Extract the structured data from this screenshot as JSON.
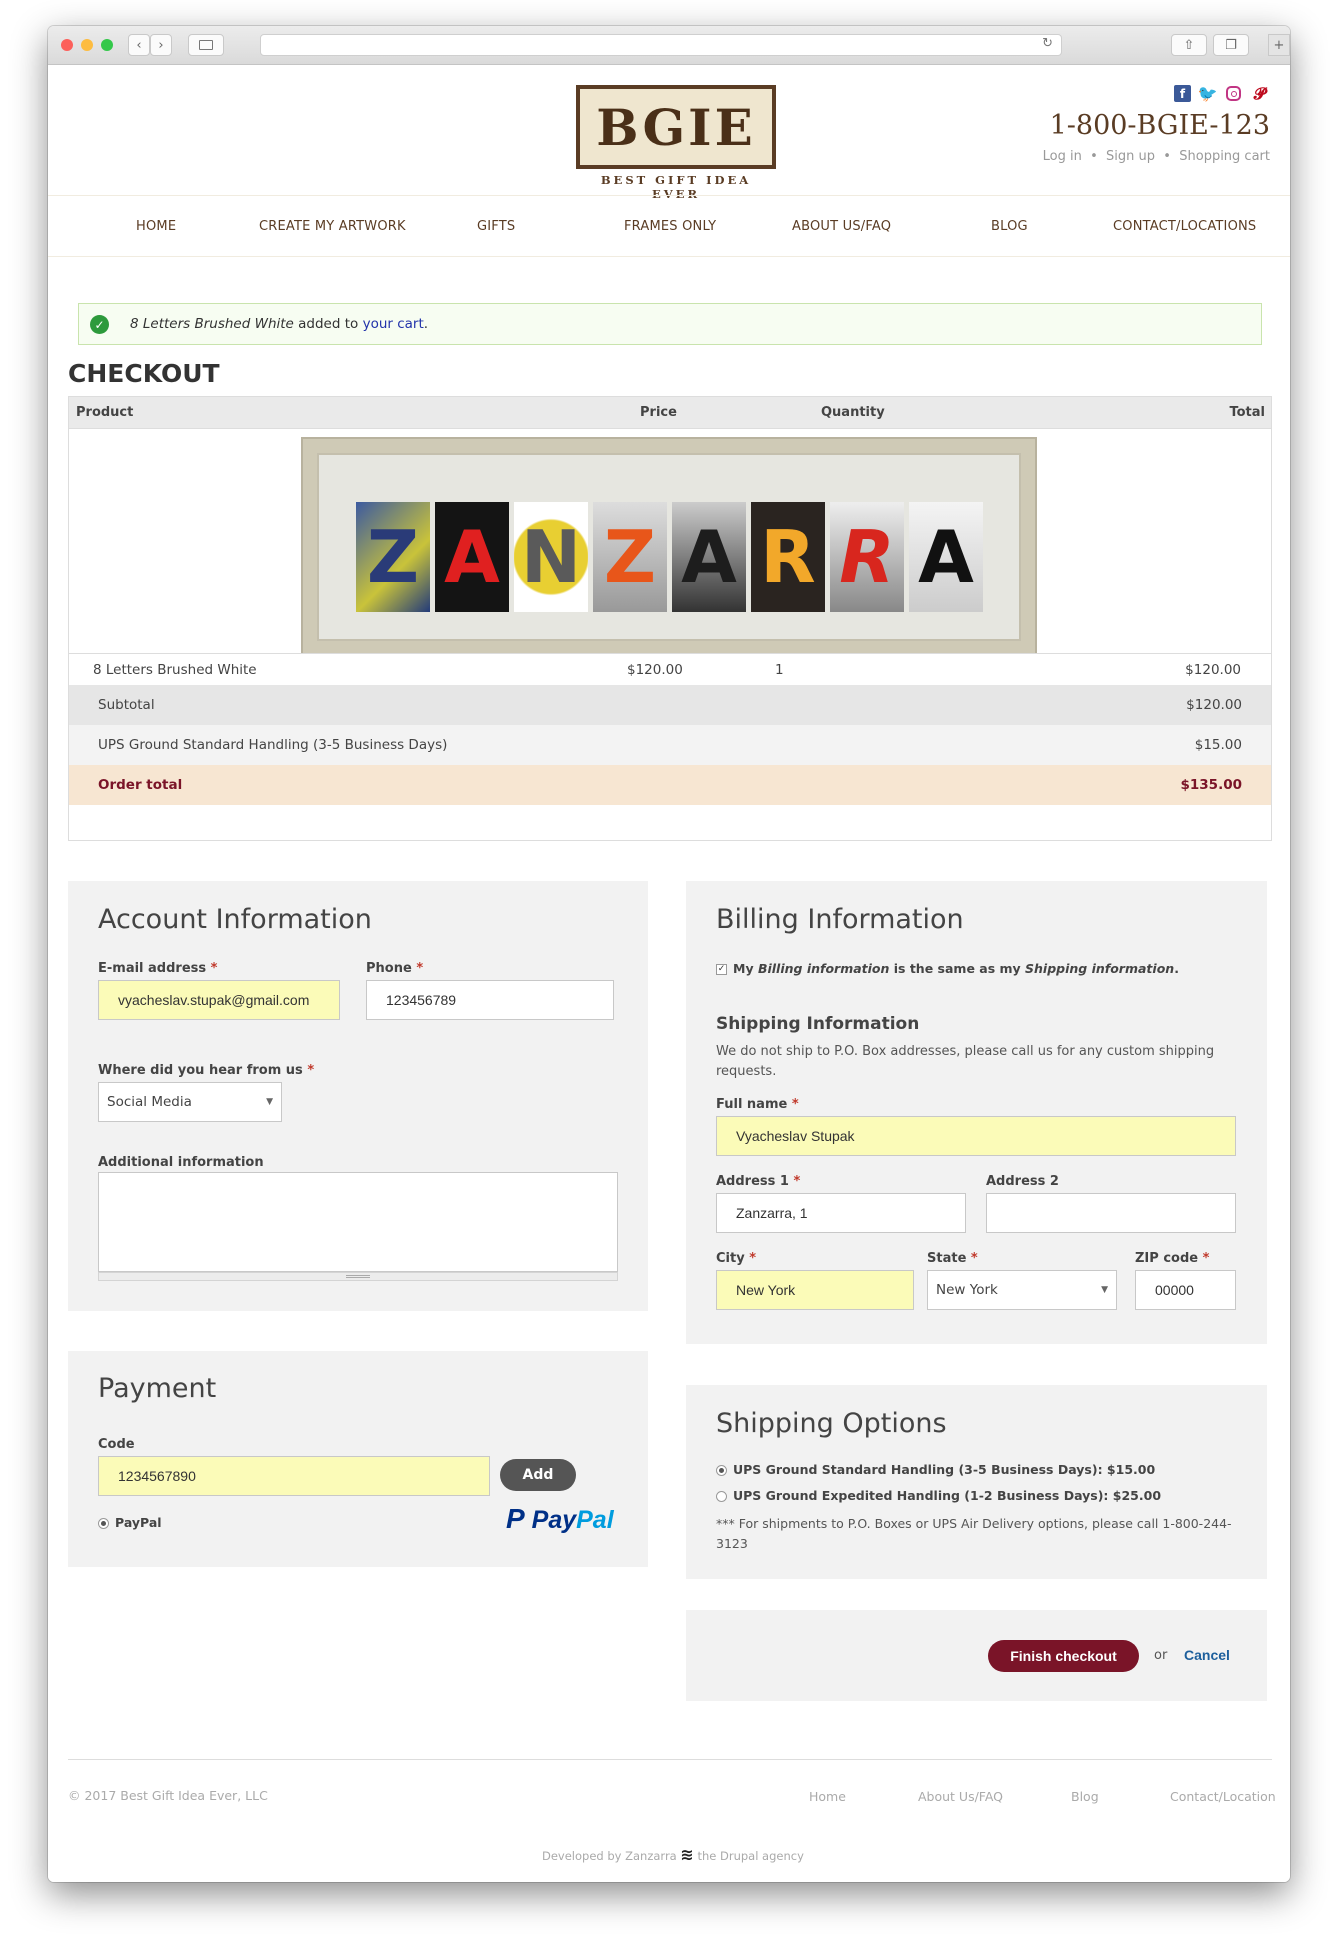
{
  "site": {
    "logo_text": "BGIE",
    "tagline": "BEST GIFT IDEA EVER",
    "phone": "1-800-BGIE-123",
    "top_links": [
      "Log in",
      "Sign up",
      "Shopping cart"
    ],
    "social_icons": [
      "facebook-icon",
      "twitter-icon",
      "instagram-icon",
      "pinterest-icon"
    ]
  },
  "nav": [
    "HOME",
    "CREATE MY ARTWORK",
    "GIFTS",
    "FRAMES ONLY",
    "ABOUT US/FAQ",
    "BLOG",
    "CONTACT/LOCATIONS"
  ],
  "alert": {
    "product": "8 Letters Brushed White",
    "middle": " added to ",
    "link": "your cart",
    "end": "."
  },
  "checkout": {
    "title": "CHECKOUT",
    "columns": {
      "product": "Product",
      "price": "Price",
      "quantity": "Quantity",
      "total": "Total"
    },
    "artwork_letters": [
      "Z",
      "A",
      "N",
      "Z",
      "A",
      "R",
      "R",
      "A"
    ],
    "item": {
      "name": "8 Letters Brushed White",
      "price": "$120.00",
      "quantity": "1",
      "total": "$120.00"
    },
    "subtotal": {
      "label": "Subtotal",
      "value": "$120.00"
    },
    "shipping": {
      "label": "UPS Ground Standard Handling (3-5 Business Days)",
      "value": "$15.00"
    },
    "order_total": {
      "label": "Order total",
      "value": "$135.00"
    }
  },
  "account": {
    "title": "Account Information",
    "email_label": "E-mail address",
    "email_value": "vyacheslav.stupak@gmail.com",
    "phone_label": "Phone",
    "phone_value": "123456789",
    "hear_label": "Where did you hear from us",
    "hear_value": "Social Media",
    "additional_label": "Additional information"
  },
  "payment": {
    "title": "Payment",
    "code_label": "Code",
    "code_value": "1234567890",
    "add_label": "Add",
    "method": "PayPal",
    "logo_p": "Pay",
    "logo_pal": "Pal"
  },
  "billing": {
    "title": "Billing Information",
    "same_pre": "My ",
    "same_b1": "Billing information",
    "same_mid": " is the same as my ",
    "same_b2": "Shipping information",
    "same_end": ".",
    "shipping_title": "Shipping Information",
    "shipping_note": "We do not ship to P.O. Box addresses, please call us for any custom shipping requests.",
    "full_name_label": "Full name",
    "full_name_value": "Vyacheslav Stupak",
    "address1_label": "Address 1",
    "address1_value": "Zanzarra, 1",
    "address2_label": "Address 2",
    "address2_value": "",
    "city_label": "City",
    "city_value": "New York",
    "state_label": "State",
    "state_value": "New York",
    "zip_label": "ZIP code",
    "zip_value": "00000"
  },
  "shipping_options": {
    "title": "Shipping Options",
    "opt1": "UPS Ground Standard Handling (3-5 Business Days): $15.00",
    "opt2": "UPS Ground Expedited Handling (1-2 Business Days): $25.00",
    "note": "*** For shipments to P.O. Boxes or UPS Air Delivery options, please call 1-800-244-3123"
  },
  "actions": {
    "finish": "Finish checkout",
    "or": "or",
    "cancel": "Cancel"
  },
  "footer": {
    "copyright": "© 2017 Best Gift Idea Ever, LLC",
    "links": [
      "Home",
      "About Us/FAQ",
      "Blog",
      "Contact/Location"
    ],
    "dev_pre": "Developed by Zanzarra",
    "dev_post": "the Drupal agency"
  },
  "colors": {
    "brand": "#5a3c24",
    "accent": "#7a1428",
    "paypal_dark": "#003087",
    "paypal_light": "#009cde"
  }
}
